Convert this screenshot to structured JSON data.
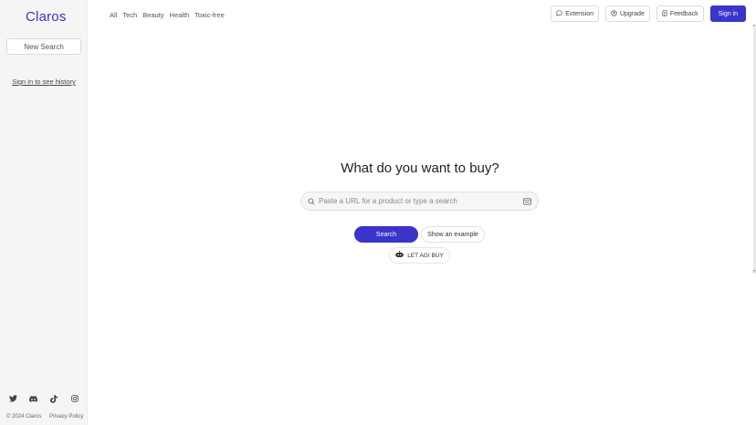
{
  "app": {
    "logo": "Claros",
    "accent_color": "#3a34c9"
  },
  "sidebar": {
    "new_search": "New Search",
    "sign_in_history": "Sign in to see history",
    "socials": [
      "twitter-icon",
      "discord-icon",
      "tiktok-icon",
      "instagram-icon"
    ],
    "copyright": "© 2024 Claros",
    "privacy": "Privacy Policy"
  },
  "nav": {
    "items": [
      "All",
      "Tech",
      "Beauty",
      "Health",
      "Toxic-free"
    ]
  },
  "header_buttons": {
    "extension": "Extension",
    "upgrade": "Upgrade",
    "feedback": "Feedback",
    "sign_in": "Sign in"
  },
  "main": {
    "headline": "What do you want to buy?",
    "search_placeholder": "Paste a URL for a product or type a search",
    "search_button": "Search",
    "example_button": "Show an example",
    "agi_button": "LET AGI BUY"
  }
}
